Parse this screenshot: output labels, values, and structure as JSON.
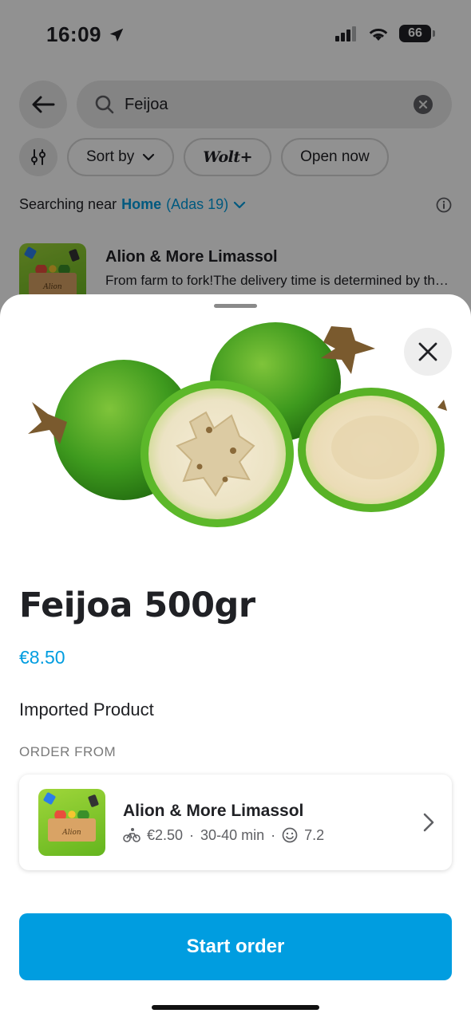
{
  "status_bar": {
    "time": "16:09",
    "battery": "66"
  },
  "search": {
    "query": "Feijoa"
  },
  "filters": {
    "sort_label": "Sort by",
    "wolt_plus_label": "Wolt+",
    "open_now_label": "Open now"
  },
  "location": {
    "prefix": "Searching near",
    "place": "Home",
    "address": "(Adas 19)"
  },
  "result": {
    "name": "Alion & More Limassol",
    "description": "From farm to fork!The delivery time is determined by the courier availability",
    "thumb_label": "Alion"
  },
  "product": {
    "title": "Feijoa 500gr",
    "price": "€8.50",
    "description": "Imported Product",
    "order_from_label": "ORDER FROM"
  },
  "venue": {
    "name": "Alion & More Limassol",
    "delivery_fee": "€2.50",
    "delivery_time": "30-40 min",
    "rating": "7.2",
    "thumb_label": "Alion"
  },
  "cta": {
    "label": "Start order"
  },
  "colors": {
    "accent": "#009de0",
    "text": "#202125"
  }
}
